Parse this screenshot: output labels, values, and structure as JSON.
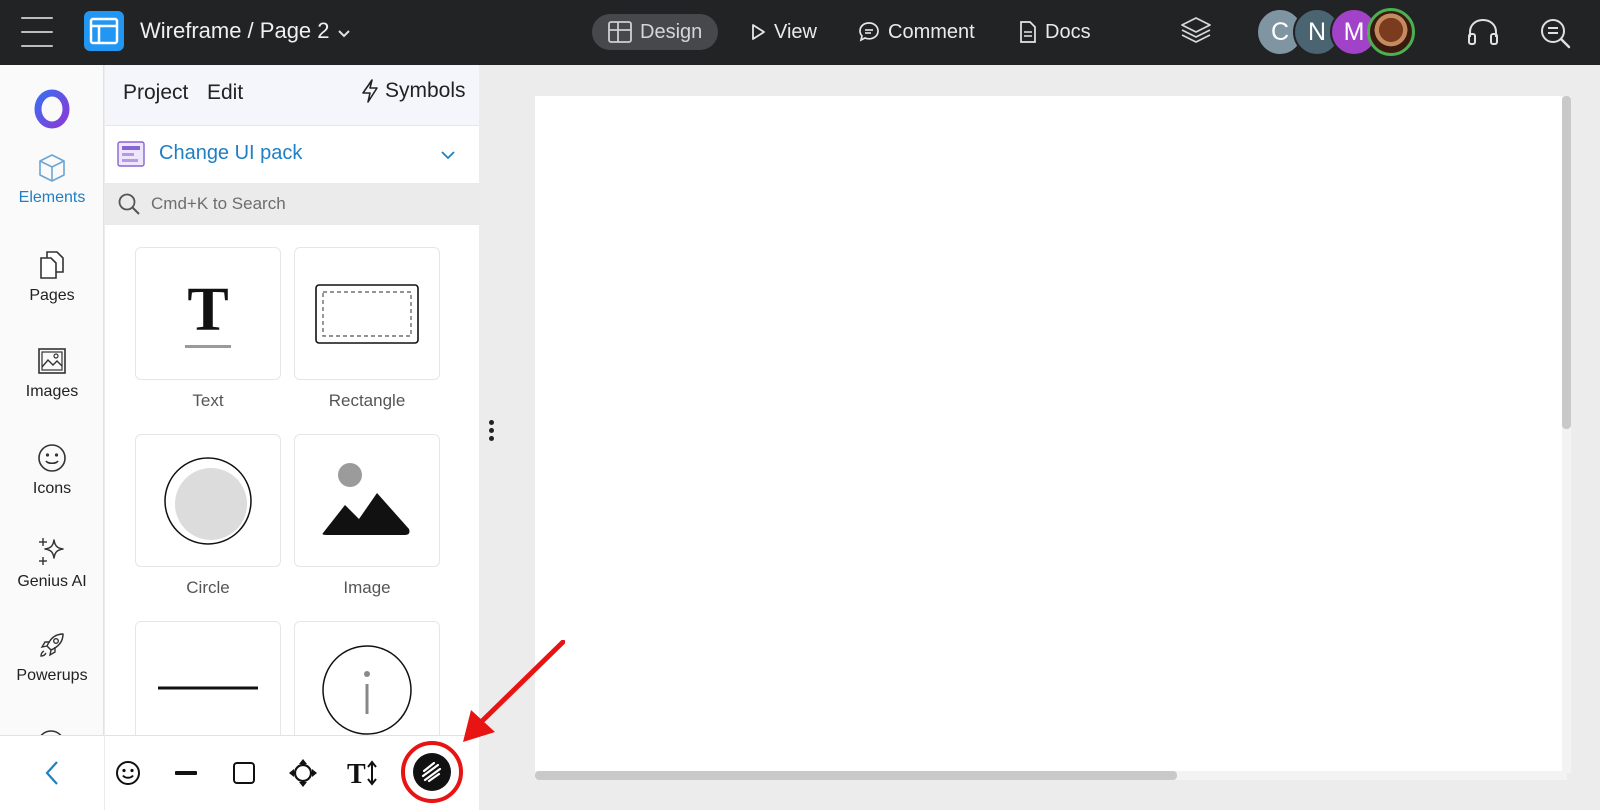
{
  "topbar": {
    "doc_title": "Wireframe / Page 2",
    "modes": [
      {
        "label": "Design",
        "icon": "layout-icon",
        "active": true
      },
      {
        "label": "View",
        "icon": "play-icon"
      },
      {
        "label": "Comment",
        "icon": "comment-icon"
      },
      {
        "label": "Docs",
        "icon": "doc-icon"
      }
    ],
    "avatars": [
      "C",
      "N",
      "M"
    ],
    "colors": {
      "bar": "#222325",
      "avatar_c": "#7f96a2",
      "avatar_n": "#4b6471",
      "avatar_m": "#a142c8"
    }
  },
  "leftnav": {
    "items": [
      {
        "label": "Elements",
        "icon": "cube-icon",
        "active": true
      },
      {
        "label": "Pages",
        "icon": "pages-icon"
      },
      {
        "label": "Images",
        "icon": "image-icon"
      },
      {
        "label": "Icons",
        "icon": "smiley-icon"
      },
      {
        "label": "Genius AI",
        "icon": "sparkle-icon"
      },
      {
        "label": "Powerups",
        "icon": "rocket-icon"
      }
    ],
    "accent": "#1f7fc3"
  },
  "panel": {
    "project": "Project",
    "edit": "Edit",
    "symbols": "Symbols",
    "ui_pack": "Change UI pack",
    "search_placeholder": "Cmd+K to Search",
    "elements": [
      "Text",
      "Rectangle",
      "Circle",
      "Image"
    ],
    "text_glyph": "T"
  },
  "bottom_tools": [
    "emoji-tool",
    "line-tool",
    "rectangle-tool",
    "move-tool",
    "text-size-tool",
    "draw-tool"
  ],
  "annotation": {
    "color": "#e81414",
    "target": "draw-tool"
  }
}
